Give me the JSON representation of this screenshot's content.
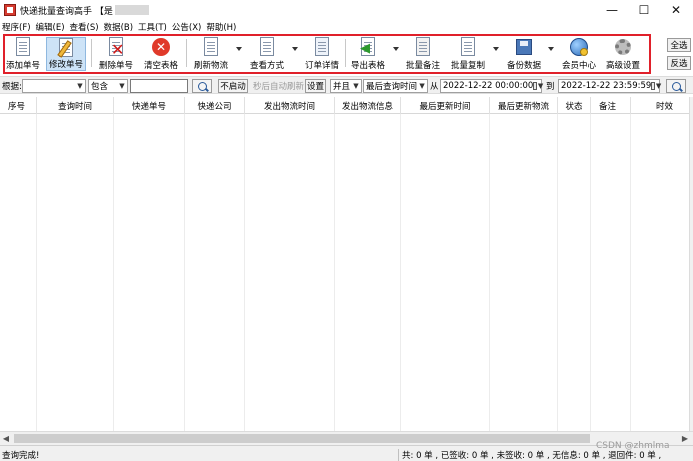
{
  "window": {
    "title": "快递批量查询高手 【是",
    "minimize_glyph": "—",
    "maximize_glyph": "☐",
    "close_glyph": "✕"
  },
  "menu": [
    "程序(F)",
    "编辑(E)",
    "查看(S)",
    "数据(B)",
    "工具(T)",
    "公告(X)",
    "帮助(H)"
  ],
  "toolbar": {
    "add_order": "添加单号",
    "edit_order": "修改单号",
    "delete_order": "删除单号",
    "clear_table": "清空表格",
    "refresh_logistics": "刷新物流",
    "view_mode": "查看方式",
    "order_details": "订单详情",
    "export_table": "导出表格",
    "batch_remark": "批量备注",
    "batch_copy": "批量复制",
    "backup_data": "备份数据",
    "member_center": "会员中心",
    "advanced_settings": "高级设置",
    "icons": {
      "add_order": "document-icon",
      "edit_order": "pencil-document-icon",
      "delete_order": "delete-x-icon",
      "clear_table": "clear-circle-icon",
      "refresh_logistics": "refresh-document-icon",
      "view_mode": "checklist-icon",
      "order_details": "details-document-icon",
      "export_table": "export-arrow-icon",
      "batch_remark": "notes-icon",
      "batch_copy": "copy-icon",
      "backup_data": "floppy-disk-icon",
      "member_center": "globe-coin-icon",
      "advanced_settings": "gear-icon"
    },
    "highlight_color": "#e0202a"
  },
  "side_buttons": {
    "select_all": "全选",
    "invert_select": "反选"
  },
  "filter": {
    "basis_label": "根据:",
    "basis_value": "",
    "match_value": "包含",
    "keyword_value": "",
    "not_started": "不启动",
    "auto_refresh_label": "秒后自动刷新",
    "settings": "设置",
    "logic_value": "并且",
    "time_field_value": "最后查询时间",
    "from_label": "从",
    "from_value": "2022-12-22 00:00:00",
    "to_label": "到",
    "to_value": "2022-12-22 23:59:59"
  },
  "table": {
    "columns": [
      "序号",
      "查询时间",
      "快递单号",
      "快递公司",
      "发出物流时间",
      "发出物流信息",
      "最后更新时间",
      "最后更新物流",
      "状态",
      "备注",
      "时效"
    ],
    "rows": []
  },
  "status": {
    "left": "查询完成!",
    "right": "共: 0 单 , 已签收: 0 单 , 未签收: 0 单 , 无信息: 0 单 , 退回件: 0 单 ,",
    "watermark": "CSDN @zhmlma"
  }
}
